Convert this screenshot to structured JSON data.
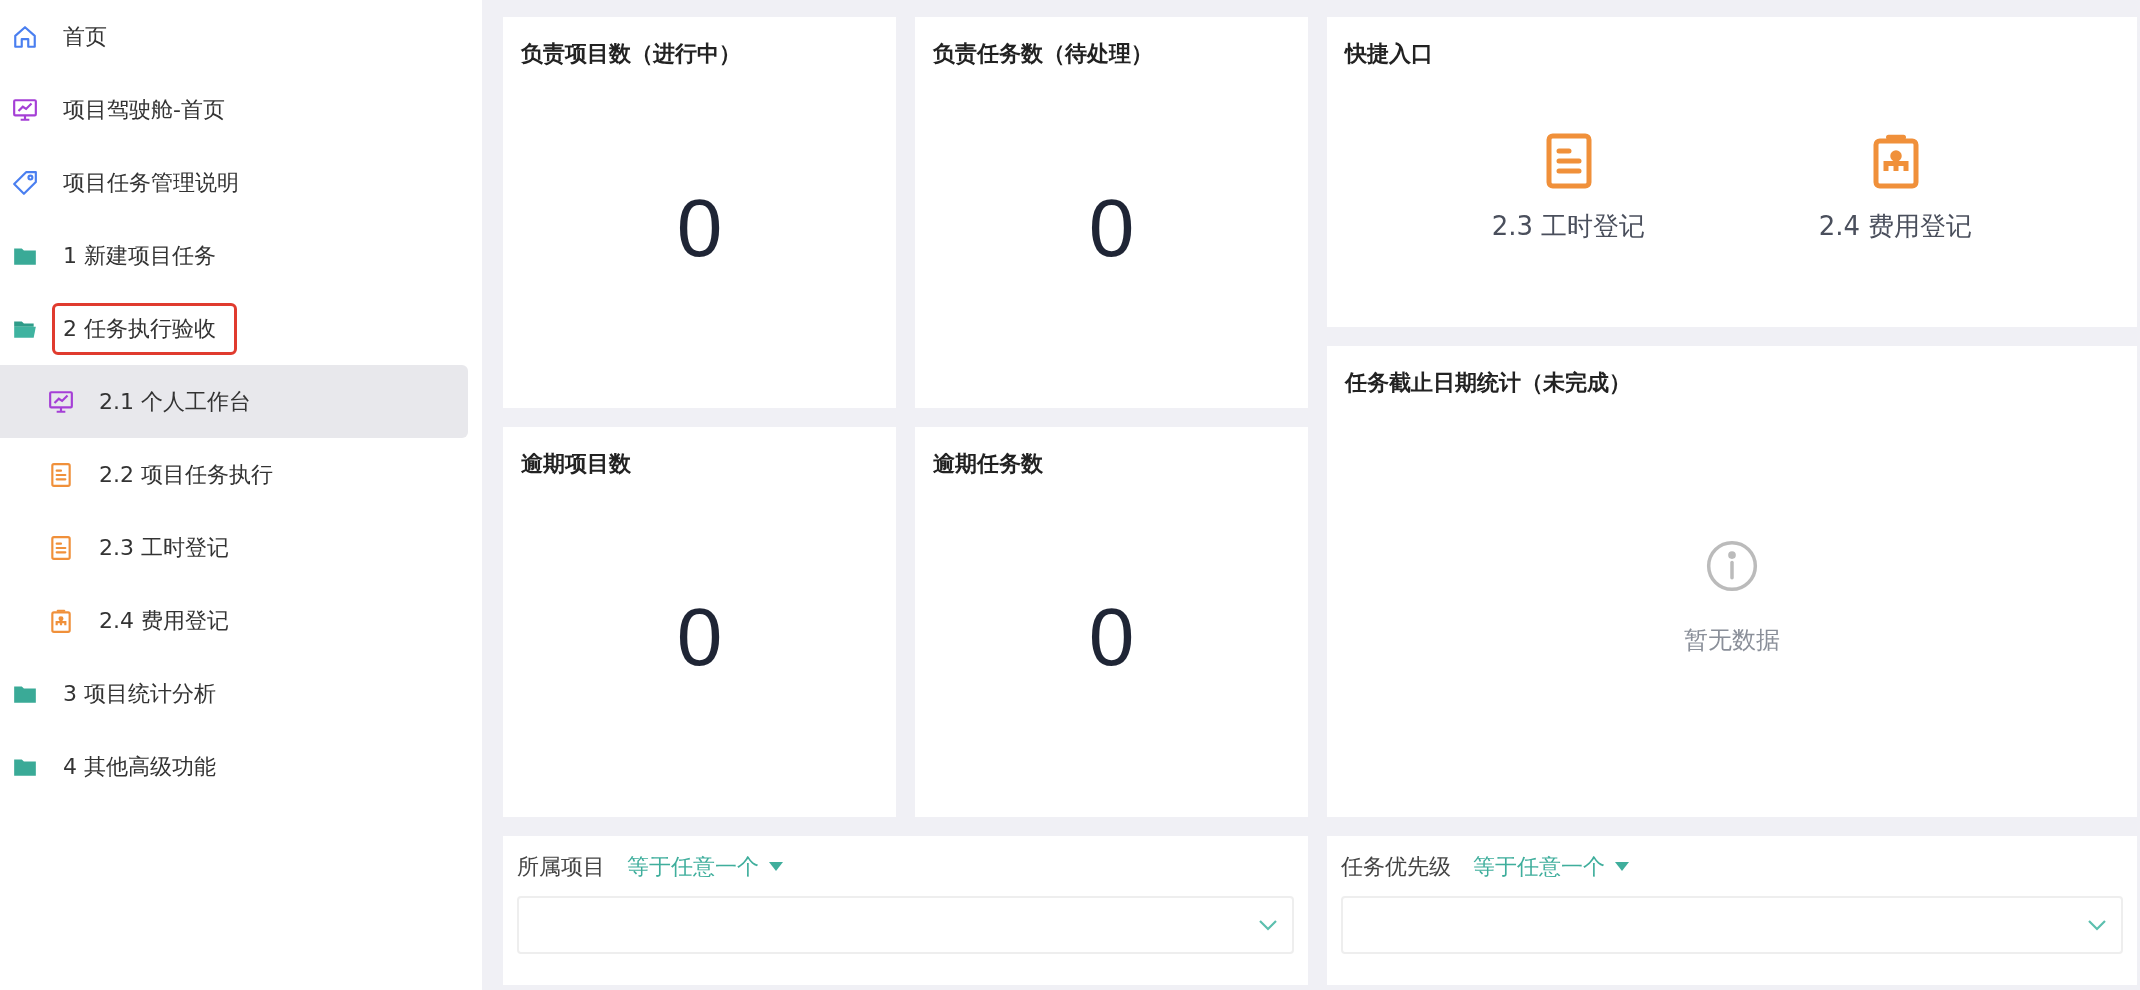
{
  "sidebar": {
    "items": [
      {
        "label": "首页",
        "kind": "home",
        "selected": false,
        "highlighted": false
      },
      {
        "label": "项目驾驶舱-首页",
        "kind": "monitor",
        "selected": false,
        "highlighted": false
      },
      {
        "label": "项目任务管理说明",
        "kind": "tag",
        "selected": false,
        "highlighted": false
      },
      {
        "label": "1 新建项目任务",
        "kind": "folder",
        "selected": false,
        "highlighted": false,
        "expanded": false
      },
      {
        "label": "2 任务执行验收",
        "kind": "folder",
        "selected": false,
        "highlighted": true,
        "expanded": true,
        "children": [
          {
            "label": "2.1 个人工作台",
            "kind": "monitor",
            "selected": true,
            "highlighted": false
          },
          {
            "label": "2.2 项目任务执行",
            "kind": "document",
            "selected": false,
            "highlighted": false
          },
          {
            "label": "2.3 工时登记",
            "kind": "document",
            "selected": false,
            "highlighted": false
          },
          {
            "label": "2.4 费用登记",
            "kind": "clipboard",
            "selected": false,
            "highlighted": false
          }
        ]
      },
      {
        "label": "3 项目统计分析",
        "kind": "folder",
        "selected": false,
        "highlighted": false,
        "expanded": false
      },
      {
        "label": "4 其他高级功能",
        "kind": "folder",
        "selected": false,
        "highlighted": false,
        "expanded": false
      }
    ]
  },
  "stats": [
    {
      "title": "负责项目数（进行中）",
      "value": "0"
    },
    {
      "title": "负责任务数（待处理）",
      "value": "0"
    },
    {
      "title": "逾期项目数",
      "value": "0"
    },
    {
      "title": "逾期任务数",
      "value": "0"
    }
  ],
  "quick_entry": {
    "title": "快捷入口",
    "items": [
      {
        "label": "2.3 工时登记",
        "kind": "document"
      },
      {
        "label": "2.4 费用登记",
        "kind": "clipboard"
      }
    ]
  },
  "deadline_chart": {
    "title": "任务截止日期统计（未完成）",
    "empty_text": "暂无数据"
  },
  "filters": [
    {
      "label": "所属项目",
      "operator": "等于任意一个"
    },
    {
      "label": "任务优先级",
      "operator": "等于任意一个"
    }
  ]
}
